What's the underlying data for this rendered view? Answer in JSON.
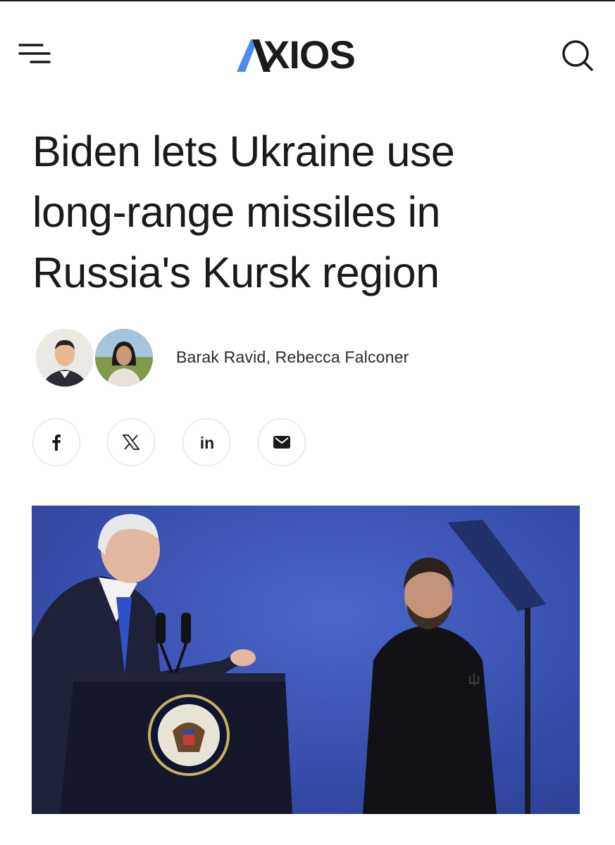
{
  "header": {
    "logo_text": "XIOS",
    "logo_accent_color": "#4a8bf2",
    "menu_icon": "hamburger-menu-icon",
    "search_icon": "search-icon"
  },
  "article": {
    "headline_lines": [
      "Biden lets Ukraine use",
      "long-range missiles in",
      "Russia's Kursk region"
    ],
    "authors": "Barak Ravid, Rebecca Falconer"
  },
  "share": {
    "buttons": [
      "facebook-icon",
      "x-icon",
      "linkedin-icon",
      "email-icon"
    ],
    "linkedin_label": "in"
  },
  "colors": {
    "text": "#1a1a1a",
    "photo_background": "#3a55b8",
    "share_border": "#dcdcdc"
  }
}
